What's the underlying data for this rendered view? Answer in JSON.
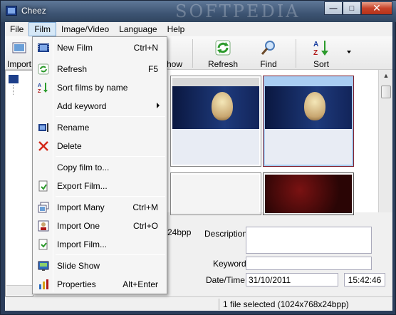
{
  "window": {
    "title": "Cheez",
    "watermark": "SOFTPEDIA",
    "minimize": "—",
    "maximize": "□",
    "close": "✕"
  },
  "menubar": {
    "items": [
      "File",
      "Film",
      "Image/Video",
      "Language",
      "Help"
    ],
    "active": "Film"
  },
  "toolbar": {
    "import_label": "Import",
    "show_label": "how",
    "refresh_label": "Refresh",
    "find_label": "Find",
    "sort_label": "Sort",
    "sort_icon_text": "A Z"
  },
  "film_menu": {
    "items": [
      {
        "label": "New Film",
        "shortcut": "Ctrl+N",
        "icon": "film-icon"
      },
      {
        "label": "Refresh",
        "shortcut": "F5",
        "icon": "refresh-icon"
      },
      {
        "label": "Sort films by name",
        "shortcut": "",
        "icon": "sort-az-icon"
      },
      {
        "label": "Add keyword",
        "shortcut": "",
        "icon": "",
        "submenu": true
      },
      {
        "label": "Rename",
        "shortcut": "",
        "icon": "rename-icon"
      },
      {
        "label": "Delete",
        "shortcut": "",
        "icon": "delete-icon"
      },
      {
        "label": "Copy film to...",
        "shortcut": "",
        "icon": ""
      },
      {
        "label": "Export Film...",
        "shortcut": "",
        "icon": "export-icon"
      },
      {
        "label": "Import Many",
        "shortcut": "Ctrl+M",
        "icon": "import-many-icon"
      },
      {
        "label": "Import One",
        "shortcut": "Ctrl+O",
        "icon": "import-one-icon"
      },
      {
        "label": "Import Film...",
        "shortcut": "",
        "icon": "import-film-icon"
      },
      {
        "label": "Slide Show",
        "shortcut": "",
        "icon": "slideshow-icon"
      },
      {
        "label": "Properties",
        "shortcut": "Alt+Enter",
        "icon": "properties-icon"
      }
    ]
  },
  "details": {
    "bpp_fragment": "24bpp",
    "description_label": "Description:",
    "description_value": "",
    "keywords_label": "Keywords:",
    "keywords_value": "",
    "datetime_label": "Date/Time:",
    "date_value": "31/10/2011",
    "time_value": "15:42:46"
  },
  "status": {
    "text": "1 file selected (1024x768x24bpp)"
  },
  "colors": {
    "accent": "#7aa7d4",
    "selection": "#a9cdf2",
    "close_button": "#c7432a"
  }
}
